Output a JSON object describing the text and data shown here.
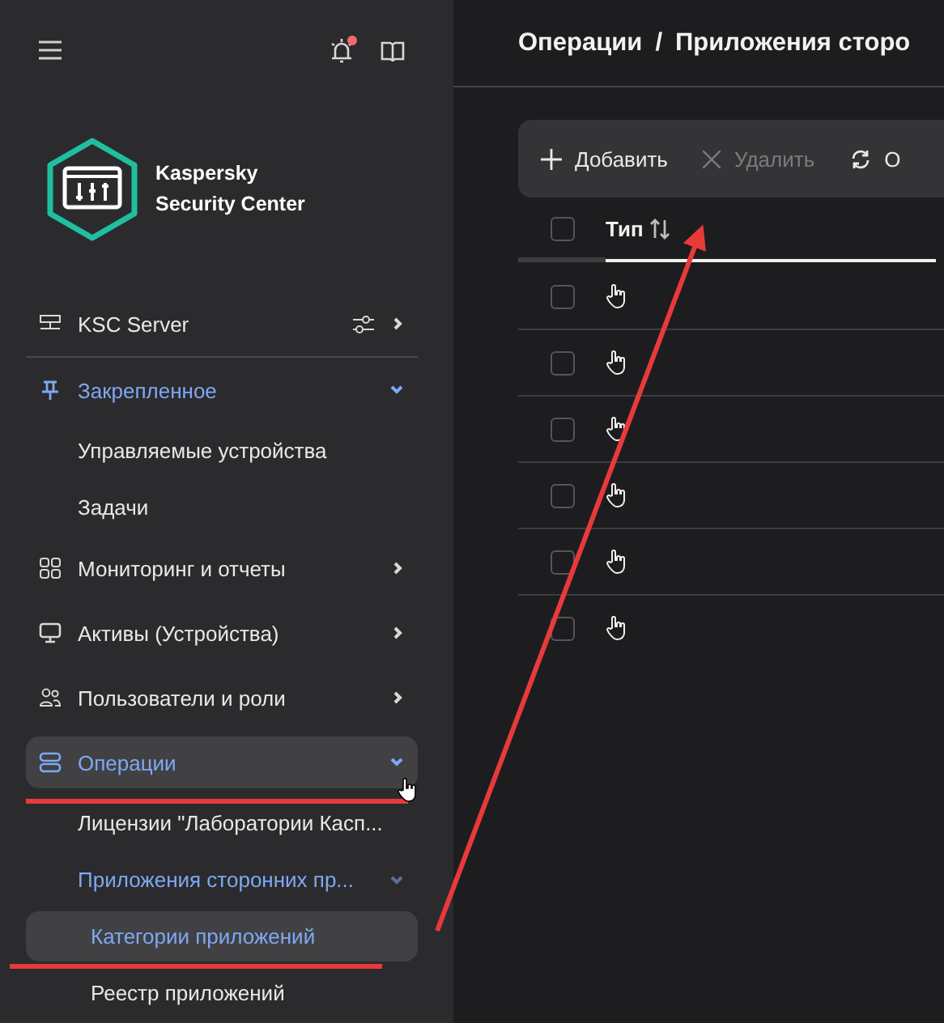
{
  "sidebar": {
    "notification_badge": true,
    "logo": {
      "line1": "Kaspersky",
      "line2": "Security Center"
    },
    "server": {
      "label": "KSC Server"
    },
    "items": [
      {
        "label": "Закрепленное",
        "kind": "pin",
        "active": true,
        "selected": false,
        "expanded": true,
        "children": [
          {
            "label": "Управляемые устройства",
            "active": false,
            "selected": false
          },
          {
            "label": "Задачи",
            "active": false,
            "selected": false
          }
        ]
      },
      {
        "label": "Мониторинг и отчеты",
        "kind": "grid",
        "active": false,
        "selected": false,
        "expanded": false
      },
      {
        "label": "Активы (Устройства)",
        "kind": "monitor",
        "active": false,
        "selected": false,
        "expanded": false
      },
      {
        "label": "Пользователи и роли",
        "kind": "users",
        "active": false,
        "selected": false,
        "expanded": false
      },
      {
        "label": "Операции",
        "kind": "stack",
        "active": true,
        "selected": true,
        "expanded": true,
        "children": [
          {
            "label": "Лицензии \"Лаборатории Касп...",
            "active": false,
            "selected": false
          },
          {
            "label": "Приложения сторонних пр...",
            "active": true,
            "selected": false,
            "expanded": true,
            "children": [
              {
                "label": "Категории приложений",
                "active": true,
                "selected": true
              },
              {
                "label": "Реестр приложений",
                "active": false,
                "selected": false
              }
            ]
          }
        ]
      }
    ]
  },
  "breadcrumb": [
    "Операции",
    "Приложения сторо"
  ],
  "breadcrumb_separator": "/",
  "toolbar": [
    {
      "kind": "add",
      "label": "Добавить",
      "disabled": false
    },
    {
      "kind": "delete",
      "label": "Удалить",
      "disabled": true
    },
    {
      "kind": "refresh",
      "label": "О",
      "disabled": false
    }
  ],
  "table": {
    "select_all_checked": false,
    "columns": [
      {
        "label": "Тип",
        "sortable": true
      }
    ],
    "rows": [
      {
        "checked": false
      },
      {
        "checked": false
      },
      {
        "checked": false
      },
      {
        "checked": false
      },
      {
        "checked": false
      },
      {
        "checked": false
      }
    ]
  }
}
